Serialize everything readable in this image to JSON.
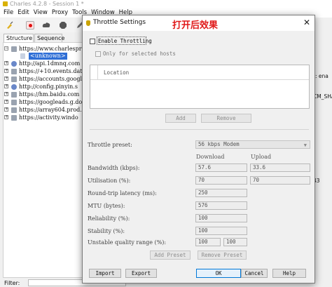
{
  "main_window": {
    "title": "Charles 4.2.8 - Session 1 *",
    "menu": [
      "File",
      "Edit",
      "View",
      "Proxy",
      "Tools",
      "Window",
      "Help"
    ],
    "tabs": [
      "Structure",
      "Sequence"
    ],
    "tree": [
      {
        "text": "https://www.charlespro",
        "expander": "−",
        "icon": "lock"
      },
      {
        "text": "<unknown>",
        "child": true
      },
      {
        "text": "http://api.1dmnq.com",
        "expander": "+",
        "icon": "globe"
      },
      {
        "text": "https://+10.events.dat",
        "expander": "+",
        "icon": "lock"
      },
      {
        "text": "https://accounts.googl",
        "expander": "+",
        "icon": "lock"
      },
      {
        "text": "http://config.pinyin.s",
        "expander": "+",
        "icon": "globe"
      },
      {
        "text": "https://hm.baidu.com",
        "expander": "+",
        "icon": "lock"
      },
      {
        "text": "https://googleads.g.do",
        "expander": "+",
        "icon": "lock"
      },
      {
        "text": "https://array604.prod.",
        "expander": "+",
        "icon": "lock"
      },
      {
        "text": "https://activity.windo",
        "expander": "+",
        "icon": "lock"
      }
    ],
    "right_edge": {
      "line1": "t: ena",
      "line2": "CM_SHA",
      "line3": "43"
    },
    "filter_label": "Filter:"
  },
  "dialog": {
    "title": "Throttle Settings",
    "annotation": "打开后效果",
    "enable_throttling": "Enable Throttling",
    "only_selected_hosts": "Only for selected hosts",
    "location_header": "Location",
    "add_button": "Add",
    "remove_button": "Remove",
    "throttle_preset_label": "Throttle preset:",
    "throttle_preset_value": "56 kbps Modem",
    "download_header": "Download",
    "upload_header": "Upload",
    "bandwidth_label": "Bandwidth (kbps):",
    "bandwidth_download": "57.6",
    "bandwidth_upload": "33.6",
    "utilisation_label": "Utilisation (%):",
    "utilisation_download": "70",
    "utilisation_upload": "70",
    "latency_label": "Round-trip latency (ms):",
    "latency_value": "250",
    "mtu_label": "MTU (bytes):",
    "mtu_value": "576",
    "reliability_label": "Reliability (%):",
    "reliability_value": "100",
    "stability_label": "Stability (%):",
    "stability_value": "100",
    "unstable_label": "Unstable quality range (%):",
    "unstable_min": "100",
    "unstable_max": "100",
    "add_preset_button": "Add Preset",
    "remove_preset_button": "Remove Preset",
    "import_button": "Import",
    "export_button": "Export",
    "ok_button": "OK",
    "cancel_button": "Cancel",
    "help_button": "Help"
  }
}
